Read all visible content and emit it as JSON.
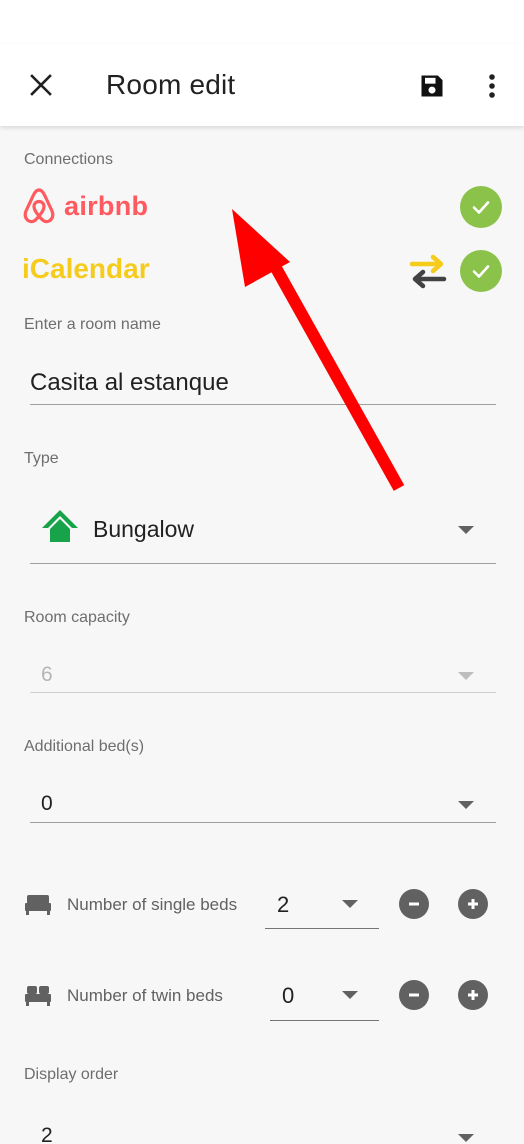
{
  "appbar": {
    "title": "Room edit",
    "close_icon": "close-icon",
    "save_icon": "save-icon",
    "more_icon": "more-vert-icon"
  },
  "connections": {
    "label": "Connections",
    "airbnb": {
      "name": "airbnb",
      "color": "#ff5a5f",
      "status_icon": "check-circle-icon"
    },
    "icalendar": {
      "name": "iCalendar",
      "color": "#f5cc1c",
      "sync_icon": "sync-arrows-icon",
      "status_icon": "check-circle-icon"
    }
  },
  "room_name": {
    "label": "Enter a room name",
    "value": "Casita al estanque"
  },
  "type": {
    "label": "Type",
    "value": "Bungalow",
    "icon": "house-icon",
    "icon_color": "#16a34a"
  },
  "capacity": {
    "label": "Room capacity",
    "value": "6"
  },
  "additional_beds": {
    "label": "Additional bed(s)",
    "value": "0"
  },
  "single_beds": {
    "label": "Number of single beds",
    "value": "2"
  },
  "twin_beds": {
    "label": "Number of twin beds",
    "value": "0"
  },
  "display_order": {
    "label": "Display order",
    "value": "2"
  },
  "annotation": {
    "arrow_color": "#ff0000"
  }
}
